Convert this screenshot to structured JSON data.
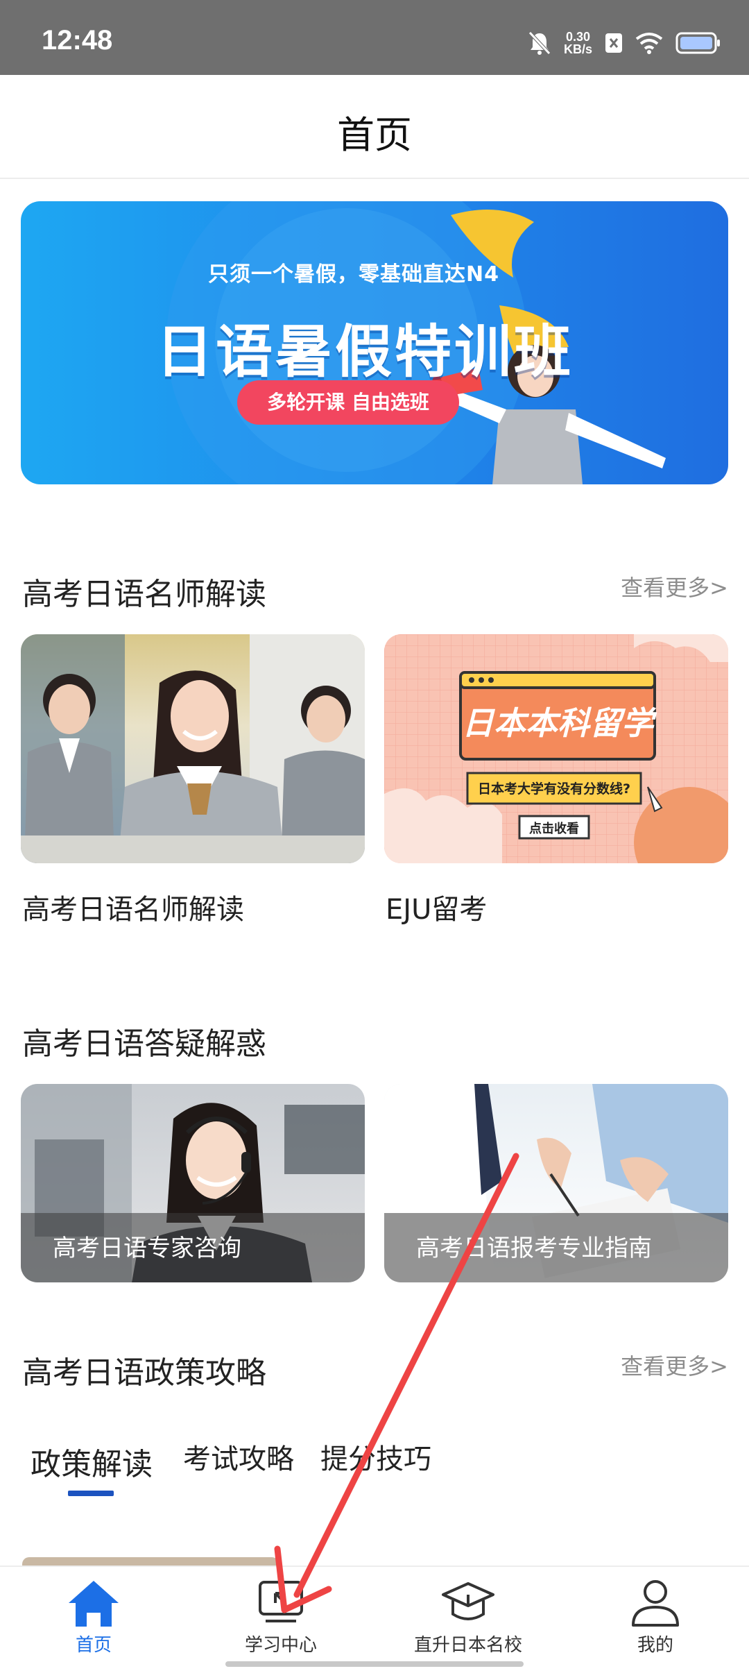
{
  "status_bar": {
    "time": "12:48",
    "net_speed_value": "0.30",
    "net_speed_unit": "KB/s"
  },
  "header": {
    "title": "首页"
  },
  "banner": {
    "subtitle": "只须一个暑假，零基础直达N4",
    "title": "日语暑假特训班",
    "pill": "多轮开课  自由选班"
  },
  "section_teachers": {
    "title": "高考日语名师解读",
    "more": "查看更多>",
    "cards": [
      {
        "caption": "高考日语名师解读"
      },
      {
        "caption": "EJU留考",
        "poster_title": "日本本科留学",
        "poster_question": "日本考大学有没有分数线?",
        "poster_button": "点击收看"
      }
    ]
  },
  "section_qa": {
    "title": "高考日语答疑解惑",
    "cards": [
      {
        "caption": "高考日语专家咨询"
      },
      {
        "caption": "高考日语报考专业指南"
      }
    ]
  },
  "section_policy": {
    "title": "高考日语政策攻略",
    "more": "查看更多>",
    "tabs": [
      {
        "label": "政策解读",
        "active": true
      },
      {
        "label": "考试攻略",
        "active": false
      },
      {
        "label": "提分技巧",
        "active": false
      }
    ]
  },
  "bottom_nav": {
    "items": [
      {
        "label": "首页",
        "icon": "home-icon",
        "active": true
      },
      {
        "label": "学习中心",
        "icon": "monitor-icon",
        "active": false
      },
      {
        "label": "直升日本名校",
        "icon": "graduation-cap-icon",
        "active": false
      },
      {
        "label": "我的",
        "icon": "user-icon",
        "active": false
      }
    ]
  },
  "colors": {
    "accent": "#1c6fe6",
    "tab_indicator": "#1c53bf",
    "annotation_arrow": "#ee4444"
  }
}
